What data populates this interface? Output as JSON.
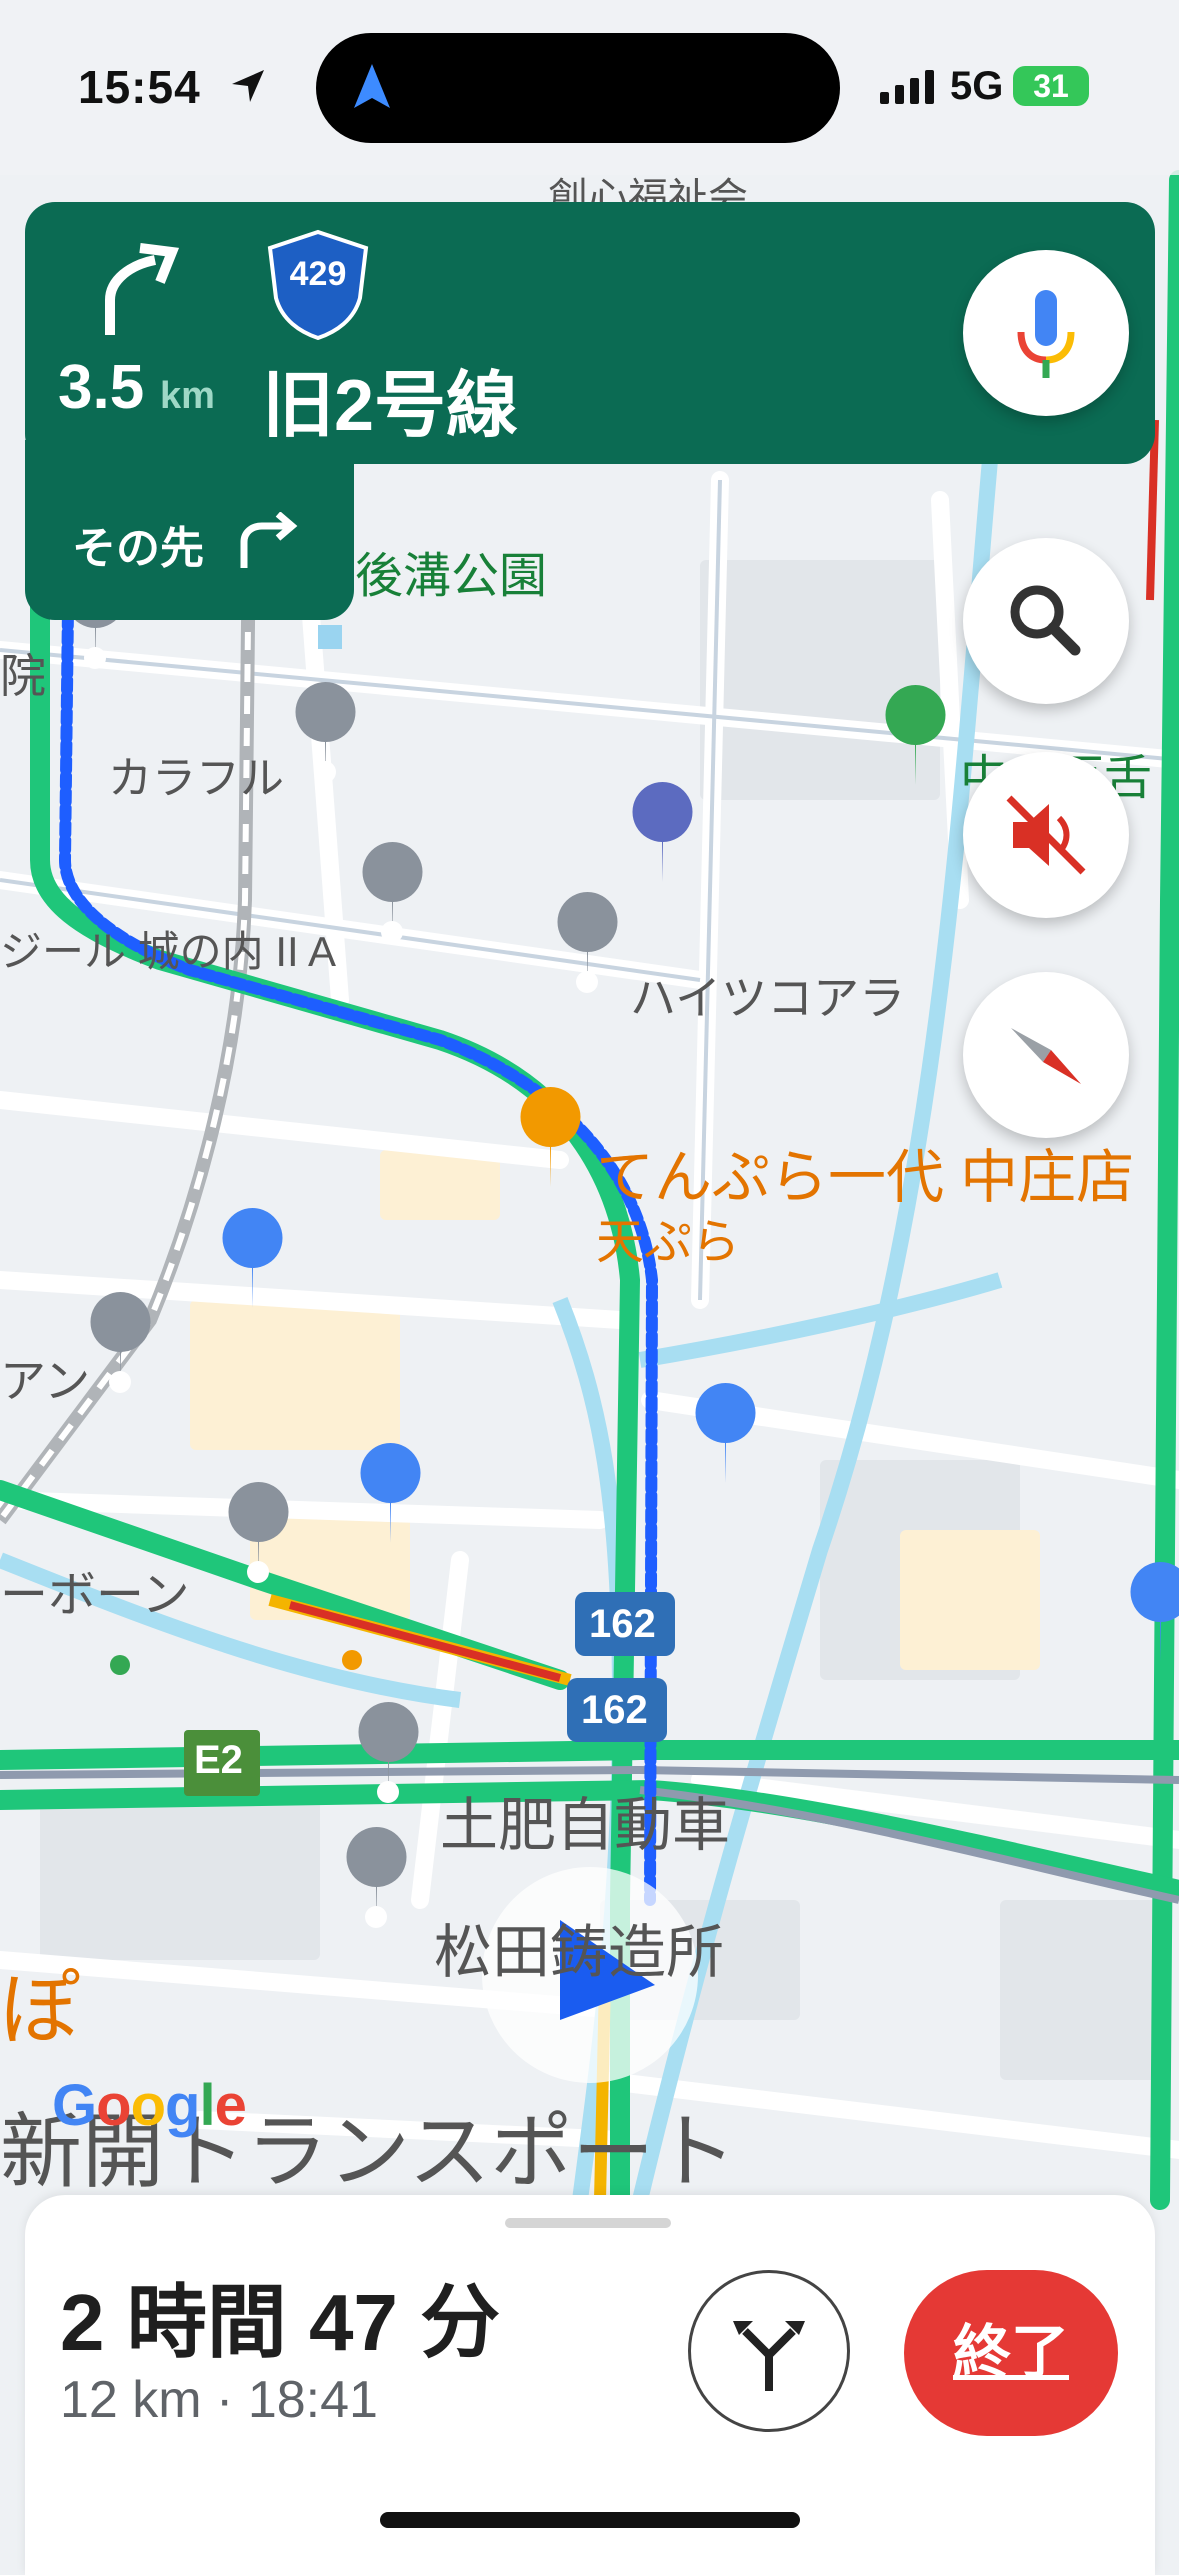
{
  "status_bar": {
    "time": "15:54",
    "network": "5G",
    "battery": "31"
  },
  "banner": {
    "distance_value": "3.5",
    "distance_unit": "km",
    "route_number": "429",
    "street_name": "旧2号線",
    "then_label": "その先"
  },
  "map_labels": {
    "park": "後溝公園",
    "top_cut": "創心福祉会",
    "hospital_cut": "院",
    "karafuru": "カラフル",
    "shiro": "ジール 城の内 II A",
    "haitsu": "ハイツコアラ",
    "tempura_name": "てんぷら一代 中庄店",
    "tempura_sub": "天ぷら",
    "right_cut": "中庄百舌",
    "left_cut1": "アン",
    "left_cut2": "ーボーン",
    "dohi": "土肥自動車",
    "matsuda": "松田鋳造所",
    "transport": "新開トランスポート",
    "orange_cut": "ぽ",
    "e2": "E2",
    "road_162_a": "162",
    "road_162_b": "162",
    "google": "Google"
  },
  "trip": {
    "duration": "2 時間 47 分",
    "details": "12 km · 18:41",
    "end_label": "終了"
  },
  "colors": {
    "banner": "#0b6b53",
    "route": "#1e5eff",
    "traffic": "#1fc67a",
    "end": "#e53935"
  }
}
